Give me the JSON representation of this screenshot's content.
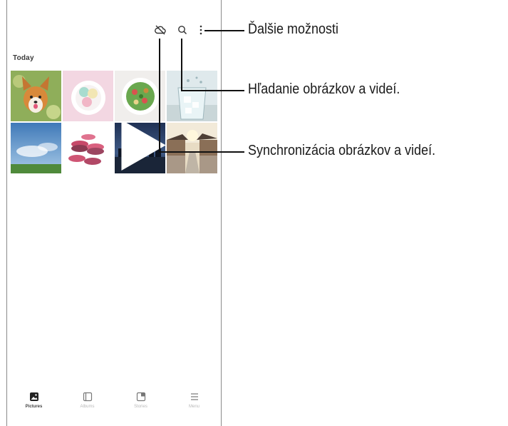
{
  "gallery": {
    "section_title": "Today",
    "thumbnails": [
      {
        "subject": "corgi dog",
        "video": false
      },
      {
        "subject": "macarons on plate",
        "video": false
      },
      {
        "subject": "salad bowl",
        "video": false
      },
      {
        "subject": "glass of water with ice",
        "video": false
      },
      {
        "subject": "blue sky and field",
        "video": false
      },
      {
        "subject": "stacked macarons",
        "video": false
      },
      {
        "subject": "city waterfront at night",
        "video": true
      },
      {
        "subject": "village street",
        "video": false
      }
    ],
    "top_bar": {
      "icons": [
        "cloud-sync-off-icon",
        "search-icon",
        "more-options-icon"
      ]
    }
  },
  "bottom_nav": [
    {
      "label": "Pictures",
      "icon": "pictures-icon",
      "active": true
    },
    {
      "label": "Albums",
      "icon": "albums-icon",
      "active": false
    },
    {
      "label": "Stories",
      "icon": "stories-icon",
      "active": false
    },
    {
      "label": "Menu",
      "icon": "menu-icon",
      "active": false
    }
  ],
  "callouts": {
    "more_options": "Ďalšie možnosti",
    "search": "Hľadanie obrázkov a videí.",
    "sync": "Synchronizácia obrázkov a videí."
  }
}
